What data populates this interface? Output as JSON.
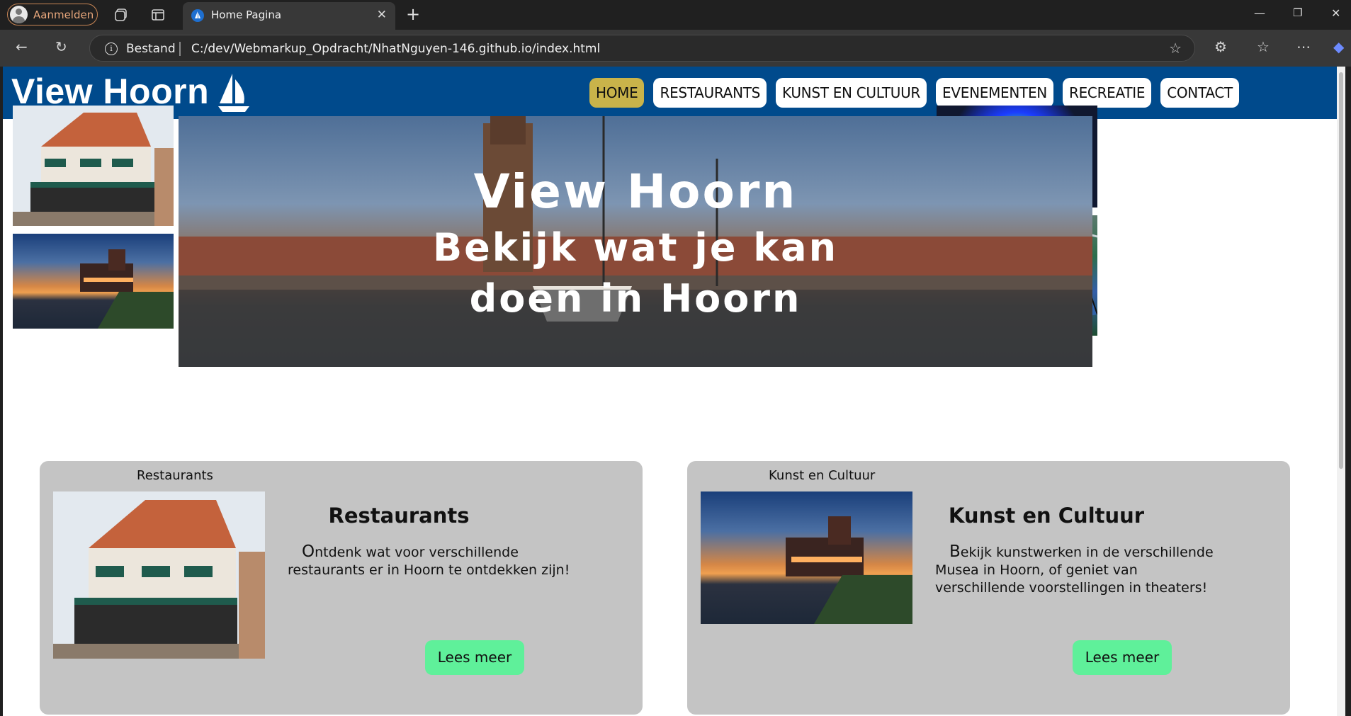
{
  "browser": {
    "profile_label": "Aanmelden",
    "tab_title": "Home Pagina",
    "address_label": "Bestand",
    "url": "C:/dev/Webmarkup_Opdracht/NhatNguyen-146.github.io/index.html"
  },
  "site": {
    "logo": "View Hoorn",
    "nav": [
      "HOME",
      "RESTAURANTS",
      "KUNST EN CULTUUR",
      "EVENEMENTEN",
      "RECREATIE",
      "CONTACT"
    ],
    "active_nav": "HOME",
    "hero": {
      "title": "View  Hoorn",
      "subtitle": "Bekijk wat je kan doen in Hoorn"
    },
    "cards": [
      {
        "caption": "Restaurants",
        "heading": "Restaurants",
        "text": "Ontdenk wat voor verschillende restaurants er in Hoorn te ontdekken zijn!",
        "button": "Lees meer"
      },
      {
        "caption": "Kunst en Cultuur",
        "heading": "Kunst en Cultuur",
        "text": "Bekijk kunstwerken in de verschillende Musea in Hoorn, of geniet van verschillende voorstellingen in theaters!",
        "button": "Lees meer"
      }
    ]
  },
  "colors": {
    "header_bg": "#004a8c",
    "active_nav_bg": "#c9b34a",
    "card_bg": "#c4c4c4",
    "button_bg": "#5ff09a"
  }
}
